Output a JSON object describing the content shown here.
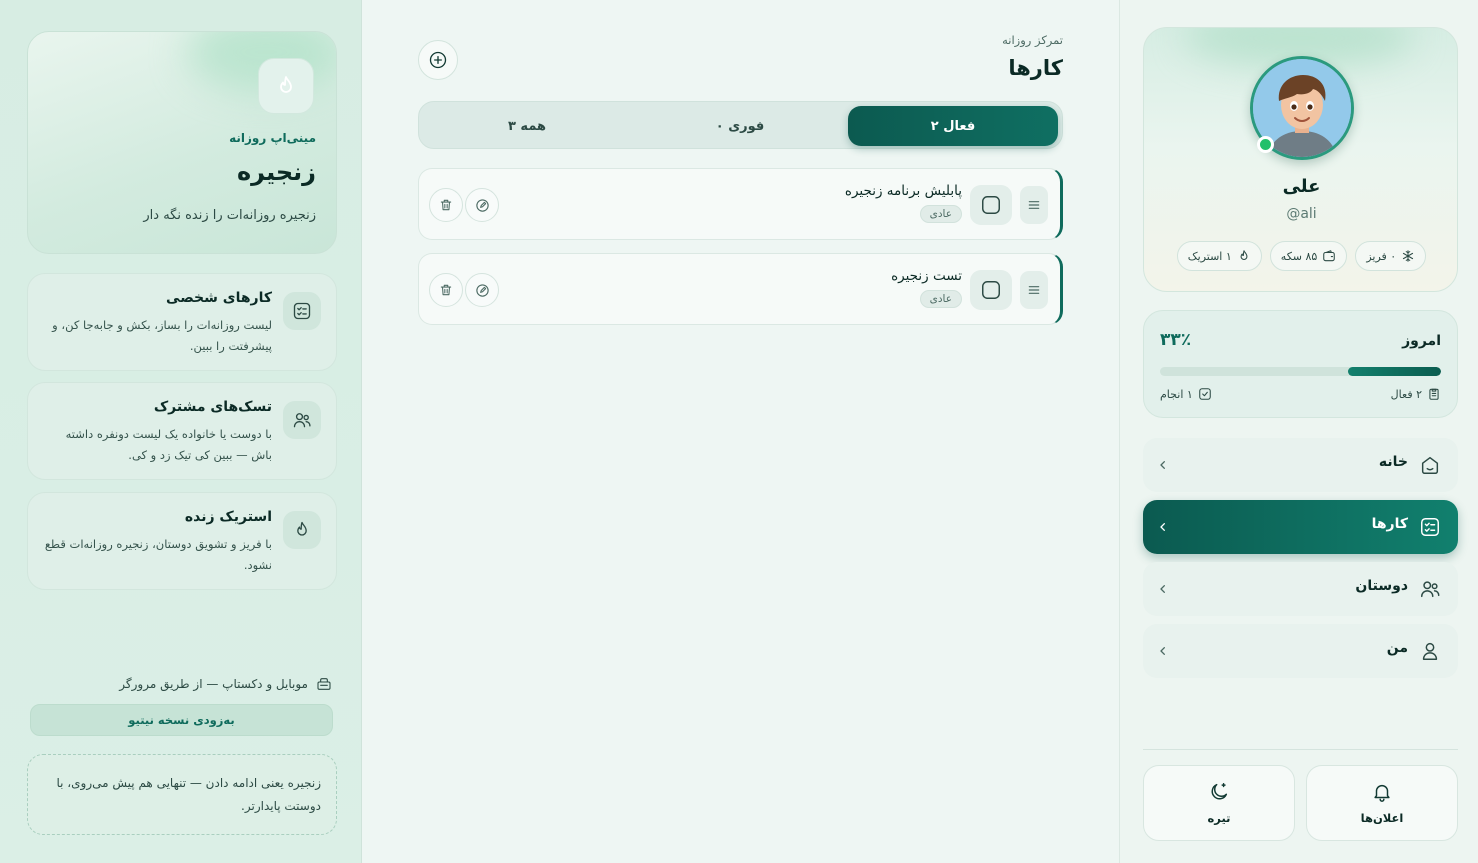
{
  "left": {
    "hero": {
      "kicker": "مینی‌اپ روزانه",
      "title": "زنجیره",
      "subtitle": "زنجیره روزانه‌ات را زنده نگه دار",
      "icon": "flame-icon"
    },
    "features": [
      {
        "title": "کارهای شخصی",
        "desc": "لیست روزانه‌ات را بساز، بکش و جابه‌جا کن، و پیشرفتت را ببین.",
        "icon": "checklist-icon"
      },
      {
        "title": "تسک‌های مشترک",
        "desc": "با دوست یا خانواده یک لیست دونفره داشته باش — ببین کی تیک زد و کی.",
        "icon": "users-icon"
      },
      {
        "title": "استریک زنده",
        "desc": "با فریز و تشویق دوستان، زنجیره روزانه‌ات قطع نشود.",
        "icon": "flame-icon"
      }
    ],
    "platform_note": "موبایل و دکستاپ — از طریق مرورگر",
    "native_button": "به‌زودی نسخه نیتیو",
    "quote": "زنجیره یعنی ادامه دادن — تنهایی هم پیش می‌روی، با دوستت پایدارتر."
  },
  "main": {
    "kicker": "تمرکز روزانه",
    "title": "کارها",
    "tabs": [
      {
        "label": "فعال ۲",
        "active": true
      },
      {
        "label": "فوری ۰",
        "active": false
      },
      {
        "label": "همه ۳",
        "active": false
      }
    ],
    "tasks": [
      {
        "title": "پابلیش برنامه زنجیره",
        "tag": "عادی"
      },
      {
        "title": "تست زنجیره",
        "tag": "عادی"
      }
    ]
  },
  "profile": {
    "name": "علی",
    "handle": "@ali",
    "chips": [
      {
        "label": "۱ استریک",
        "icon": "flame-icon"
      },
      {
        "label": "۸۵ سکه",
        "icon": "wallet-icon"
      },
      {
        "label": "۰ فریز",
        "icon": "snowflake-icon"
      }
    ]
  },
  "today": {
    "label": "امروز",
    "percent_text": "۳۳٪",
    "progress": 0.33,
    "active_text": "۲ فعال",
    "done_text": "۱ انجام"
  },
  "nav": [
    {
      "label": "خانه",
      "icon": "home-icon",
      "active": false
    },
    {
      "label": "کارها",
      "icon": "tasks-icon",
      "active": true
    },
    {
      "label": "دوستان",
      "icon": "users-icon",
      "active": false
    },
    {
      "label": "من",
      "icon": "user-icon",
      "active": false
    }
  ],
  "bottom": {
    "notifications": "اعلان‌ها",
    "theme": "تیره"
  },
  "colors": {
    "accent": "#0f6b5c",
    "accent_dark": "#0b5a50",
    "online": "#22c06a"
  }
}
